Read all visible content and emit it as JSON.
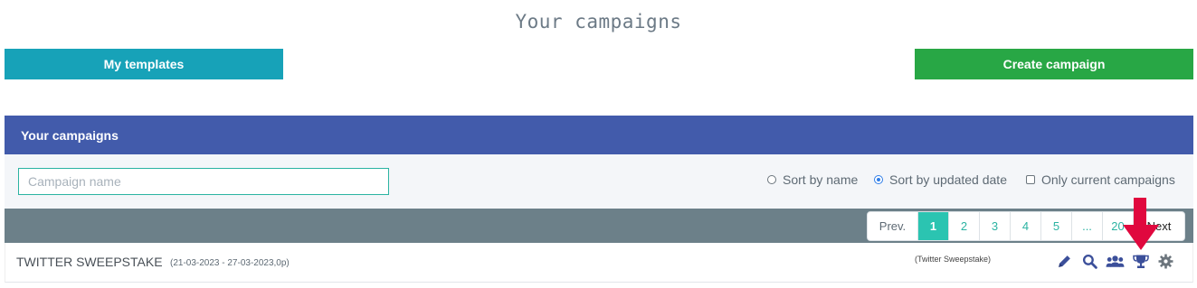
{
  "page": {
    "title": "Your campaigns"
  },
  "toolbar": {
    "templates_label": "My templates",
    "create_label": "Create campaign"
  },
  "panel": {
    "title": "Your campaigns"
  },
  "filters": {
    "search_placeholder": "Campaign name",
    "sort_name_label": "Sort by name",
    "sort_date_label": "Sort by updated date",
    "current_label": "Only current campaigns",
    "selected_sort": "updated date"
  },
  "pagination": {
    "prev_label": "Prev.",
    "pages": [
      "1",
      "2",
      "3",
      "4",
      "5",
      "...",
      "20"
    ],
    "active_page": "1",
    "next_label": "Next"
  },
  "campaigns": [
    {
      "name": "TWITTER SWEEPSTAKE",
      "dates": "(21-03-2023 - 27-03-2023,0p)",
      "type": "(Twitter Sweepstake)",
      "actions": [
        "pencil-icon",
        "search-icon",
        "users-icon",
        "trophy-icon",
        "gear-icon"
      ]
    }
  ],
  "colors": {
    "header": "#425bab",
    "templates_button": "#17a2b8",
    "create_button": "#28a745",
    "active_page": "#2bc4b1",
    "annotation_arrow": "#e0083e"
  }
}
